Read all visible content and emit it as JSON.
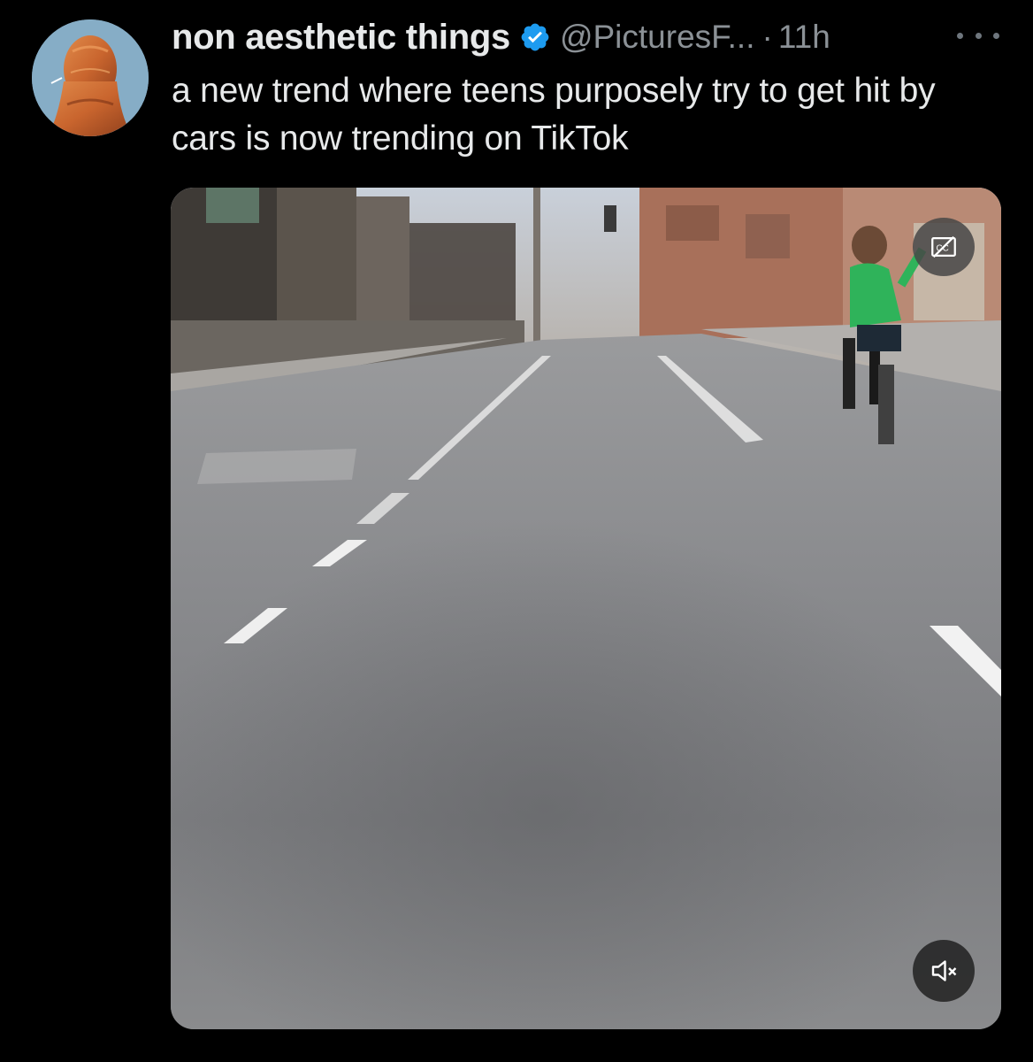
{
  "author": {
    "display_name": "non aesthetic things",
    "handle": "@PicturesF...",
    "separator": "·",
    "timestamp": "11h",
    "verified": true,
    "verified_color": "#1d9bf0"
  },
  "tweet": {
    "text": "a new trend where teens purposely try to get hit by cars is now trending on TikTok"
  },
  "media": {
    "type": "video",
    "captions_icon": "cc-off-icon",
    "sound_icon": "volume-muted-icon"
  },
  "icons": {
    "more": "more-options-icon",
    "verified": "verified-badge-icon"
  },
  "colors": {
    "background": "#000000",
    "text": "#e7e9ea",
    "secondary_text": "#8b9196"
  }
}
